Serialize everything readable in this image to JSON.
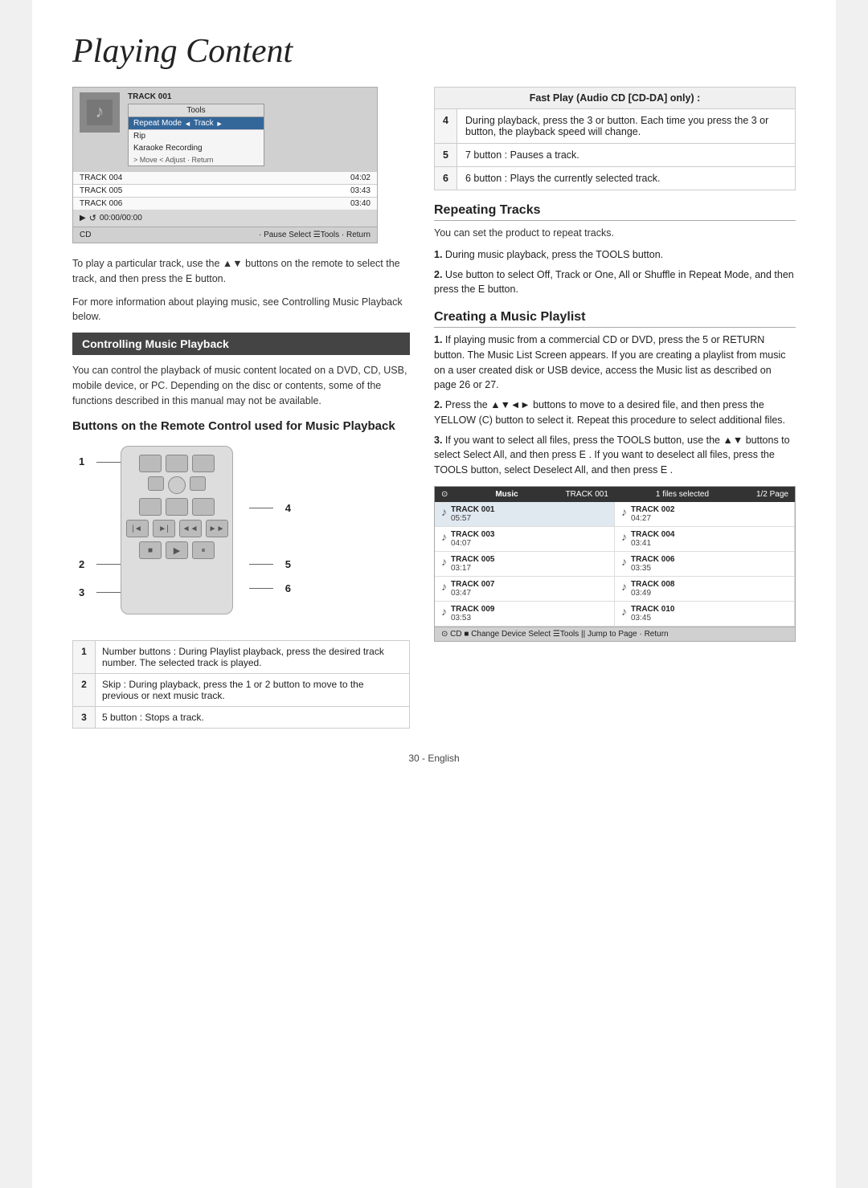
{
  "page": {
    "title": "Playing Content",
    "page_number": "30 - English"
  },
  "cd_player": {
    "track": "TRACK 001",
    "time": "00:00/00:00",
    "source": "CD",
    "tools_header": "Tools",
    "repeat_mode_label": "Repeat Mode",
    "repeat_mode_value": "Track",
    "rip_label": "Rip",
    "karaoke_label": "Karaoke Recording",
    "nav_hint": "> Move  < Adjust  · Return",
    "tracks": [
      {
        "name": "TRACK 004",
        "time": "04:02"
      },
      {
        "name": "TRACK 005",
        "time": "03:43"
      },
      {
        "name": "TRACK 006",
        "time": "03:40"
      }
    ],
    "bottom_nav": "· Pause    Select    ☰Tools    · Return"
  },
  "left_col": {
    "desc1": "To play a particular track, use the ▲▼ buttons on the remote to select the track, and then press the E  button.",
    "desc2": "For more information about playing music, see Controlling Music Playback below.",
    "section_heading": "Controlling Music Playback",
    "section_desc": "You can control the playback of music content located on a DVD, CD, USB, mobile device, or PC. Depending on the disc or contents, some of the functions described in this manual may not be available.",
    "buttons_heading": "Buttons on the Remote Control used for Music Playback",
    "labels": [
      "1",
      "2",
      "3",
      "4",
      "5",
      "6"
    ],
    "table": [
      {
        "num": "1",
        "text": "Number buttons : During Playlist playback, press the desired track number. The selected track is played."
      },
      {
        "num": "2",
        "text": "Skip : During playback, press the 1  or 2  button to move to the previous or next music track."
      },
      {
        "num": "3",
        "text": "5  button : Stops a track."
      }
    ]
  },
  "right_col": {
    "fast_play_title": "Fast Play (Audio CD [CD-DA] only) :",
    "fast_play_rows": [
      {
        "num": "4",
        "text": "During playback, press the 3  or  button. Each time you press the 3  or  button, the playback speed will change."
      },
      {
        "num": "5",
        "text": "7  button : Pauses a track."
      },
      {
        "num": "6",
        "text": "6  button : Plays the currently selected track."
      }
    ],
    "repeating_heading": "Repeating Tracks",
    "repeating_desc": "You can set the product to repeat tracks.",
    "repeating_steps": [
      {
        "num": "1.",
        "text": "During music playback, press the TOOLS button."
      },
      {
        "num": "2.",
        "text": "Use  button to select Off, Track or One, All or Shuffle in Repeat Mode, and then press the E  button."
      }
    ],
    "creating_heading": "Creating a Music Playlist",
    "creating_steps": [
      {
        "num": "1.",
        "text": "If playing music from a commercial CD or DVD, press the 5  or RETURN button. The Music List Screen appears. If you are creating a playlist from music on a user created disk or USB device, access the Music list as described on page 26 or 27."
      },
      {
        "num": "2.",
        "text": "Press the ▲▼◄► buttons to move to a desired file, and then press the YELLOW (C) button to select it. Repeat this procedure to select additional files."
      },
      {
        "num": "3.",
        "text": "If you want to select all files, press the TOOLS button, use the ▲▼ buttons to select Select All, and then press E  . If you want to deselect all files, press the TOOLS button, select Deselect All, and then press E  ."
      }
    ],
    "music_ui": {
      "header_icon": "⊙",
      "title": "Music",
      "track_label": "TRACK 001",
      "files_selected": "1 files selected",
      "page_info": "1/2 Page",
      "tracks": [
        {
          "name": "TRACK 001",
          "time": "05:57",
          "selected": true
        },
        {
          "name": "TRACK 002",
          "time": "04:27",
          "selected": false
        },
        {
          "name": "TRACK 003",
          "time": "04:07",
          "selected": false
        },
        {
          "name": "TRACK 004",
          "time": "03:41",
          "selected": false
        },
        {
          "name": "TRACK 005",
          "time": "03:17",
          "selected": false
        },
        {
          "name": "TRACK 006",
          "time": "03:35",
          "selected": false
        },
        {
          "name": "TRACK 007",
          "time": "03:47",
          "selected": false
        },
        {
          "name": "TRACK 008",
          "time": "03:49",
          "selected": false
        },
        {
          "name": "TRACK 009",
          "time": "03:53",
          "selected": false
        },
        {
          "name": "TRACK 010",
          "time": "03:45",
          "selected": false
        }
      ],
      "footer": "⊙ CD  ■ Change Device    Select  ☰Tools  ||  Jump to Page  · Return"
    }
  }
}
